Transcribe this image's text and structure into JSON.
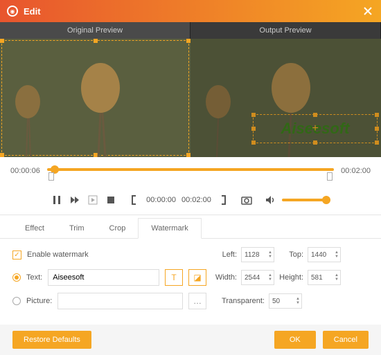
{
  "titlebar": {
    "title": "Edit"
  },
  "preview": {
    "original_label": "Original Preview",
    "output_label": "Output Preview",
    "watermark_text": "Aiseesoft"
  },
  "timeline": {
    "current": "00:00:06",
    "total": "00:02:00"
  },
  "controls": {
    "trim_start": "00:00:00",
    "trim_end": "00:02:00"
  },
  "tabs": {
    "effect": "Effect",
    "trim": "Trim",
    "crop": "Crop",
    "watermark": "Watermark"
  },
  "panel": {
    "enable_label": "Enable watermark",
    "text_label": "Text:",
    "text_value": "Aiseesoft",
    "picture_label": "Picture:",
    "left_label": "Left:",
    "left_value": "1128",
    "top_label": "Top:",
    "top_value": "1440",
    "width_label": "Width:",
    "width_value": "2544",
    "height_label": "Height:",
    "height_value": "581",
    "transparent_label": "Transparent:",
    "transparent_value": "50"
  },
  "footer": {
    "restore": "Restore Defaults",
    "ok": "OK",
    "cancel": "Cancel"
  }
}
